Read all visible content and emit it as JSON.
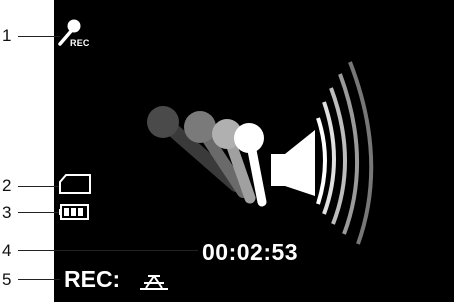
{
  "callouts": [
    "1",
    "2",
    "3",
    "4",
    "5"
  ],
  "recording": {
    "rec_badge": "REC",
    "elapsed_time": "00:02:53",
    "status_label": "REC:"
  },
  "icons": [
    "microphone-icon",
    "memory-card-icon",
    "battery-icon",
    "recording-animation-icon",
    "input-source-icon"
  ],
  "colors": {
    "screen": "#000000",
    "foreground": "#ffffff",
    "callout": "#222222"
  },
  "battery_level": 1.0
}
